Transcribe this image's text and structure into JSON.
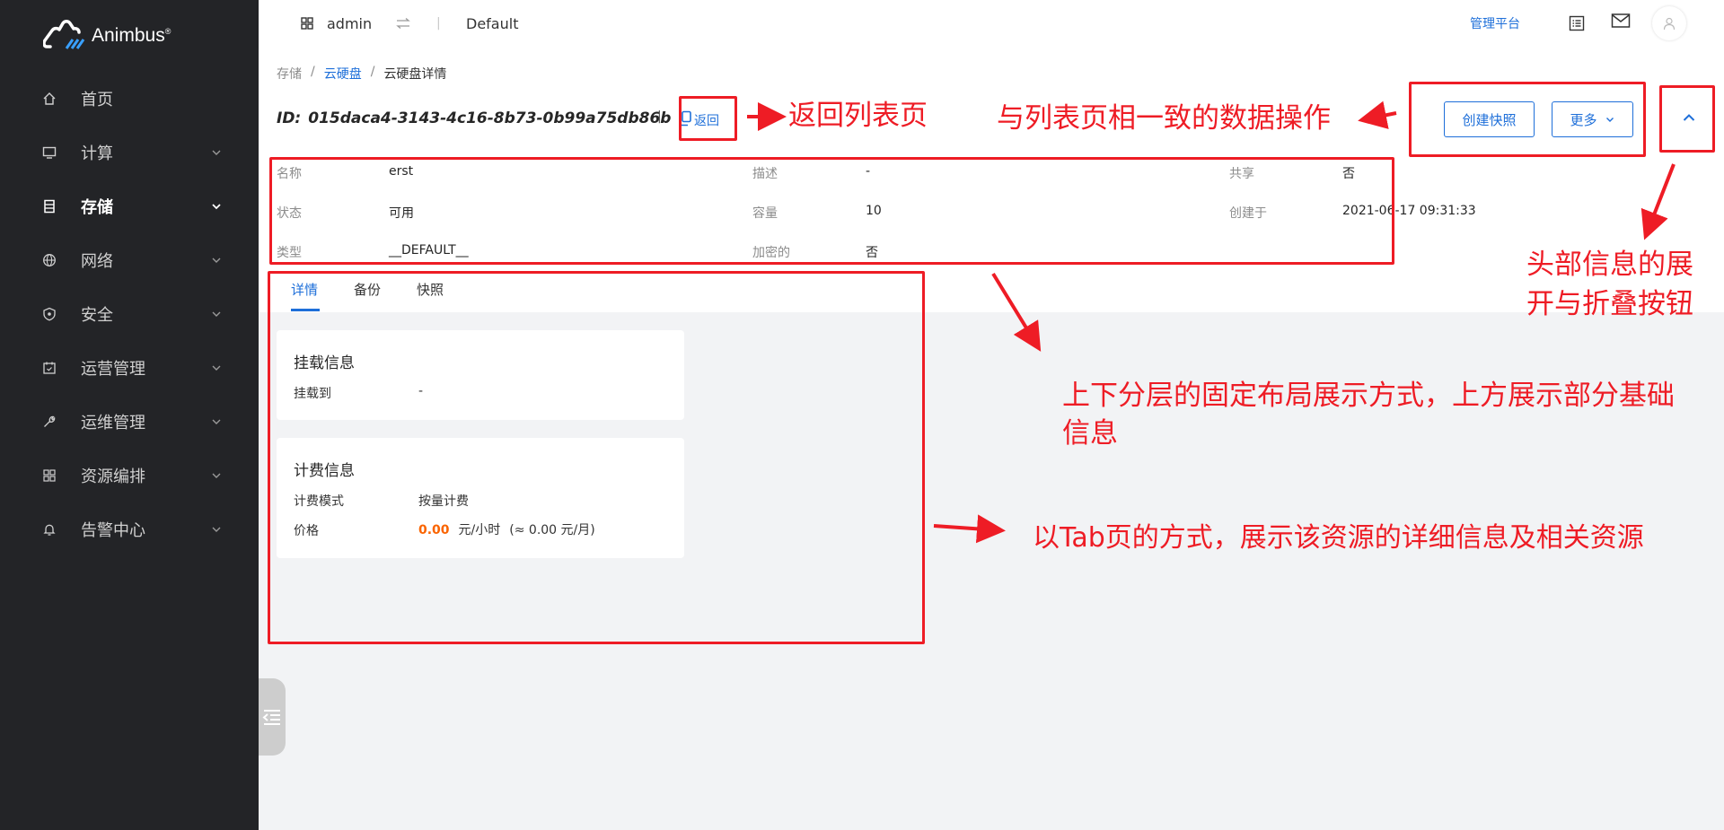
{
  "brand": {
    "name": "Animbus",
    "mark": "®"
  },
  "sidebar": {
    "items": [
      {
        "label": "首页",
        "icon": "home-icon",
        "has_chevron": false,
        "active": false
      },
      {
        "label": "计算",
        "icon": "monitor-icon",
        "has_chevron": true,
        "active": false
      },
      {
        "label": "存储",
        "icon": "storage-icon",
        "has_chevron": true,
        "active": true
      },
      {
        "label": "网络",
        "icon": "globe-icon",
        "has_chevron": true,
        "active": false
      },
      {
        "label": "安全",
        "icon": "shield-icon",
        "has_chevron": true,
        "active": false
      },
      {
        "label": "运营管理",
        "icon": "calendar-icon",
        "has_chevron": true,
        "active": false
      },
      {
        "label": "运维管理",
        "icon": "wrench-icon",
        "has_chevron": true,
        "active": false
      },
      {
        "label": "资源编排",
        "icon": "grid-icon",
        "has_chevron": true,
        "active": false
      },
      {
        "label": "告警中心",
        "icon": "bell-icon",
        "has_chevron": true,
        "active": false
      }
    ]
  },
  "topbar": {
    "user": "admin",
    "project": "Default",
    "platform_link": "管理平台"
  },
  "breadcrumb": {
    "root": "存储",
    "parent": "云硬盘",
    "current": "云硬盘详情",
    "sep": "/"
  },
  "header": {
    "id_prefix": "ID:",
    "id_value": "015daca4-3143-4c16-8b73-0b99a75db86b",
    "back_label": "返回",
    "create_snapshot_label": "创建快照",
    "more_label": "更多"
  },
  "info": {
    "name_label": "名称",
    "name_value": "erst",
    "desc_label": "描述",
    "desc_value": "-",
    "share_label": "共享",
    "share_value": "否",
    "status_label": "状态",
    "status_value": "可用",
    "capacity_label": "容量",
    "capacity_value": "10",
    "created_label": "创建于",
    "created_value": "2021-06-17 09:31:33",
    "type_label": "类型",
    "type_value": "__DEFAULT__",
    "encrypted_label": "加密的",
    "encrypted_value": "否"
  },
  "tabs": [
    {
      "label": "详情",
      "active": true
    },
    {
      "label": "备份",
      "active": false
    },
    {
      "label": "快照",
      "active": false
    }
  ],
  "mount_card": {
    "title": "挂载信息",
    "label": "挂载到",
    "value": "-"
  },
  "billing_card": {
    "title": "计费信息",
    "mode_label": "计费模式",
    "mode_value": "按量计费",
    "price_label": "价格",
    "price_value": "0.00",
    "price_unit": "元/小时",
    "price_month": "(≈ 0.00 元/月)"
  },
  "annotations": {
    "back_note": "返回列表页",
    "ops_note": "与列表页相一致的数据操作",
    "toggle_note_line1": "头部信息的展",
    "toggle_note_line2": "开与折叠按钮",
    "layout_note_line1": "上下分层的固定布局展示方式，上方展示部分基础",
    "layout_note_line2": "信息",
    "tab_note": "以Tab页的方式，展示该资源的详细信息及相关资源"
  },
  "colors": {
    "accent": "#1e6fd9",
    "annotation": "#ee1c25",
    "price": "#fa6400",
    "sidebar": "#232427"
  }
}
